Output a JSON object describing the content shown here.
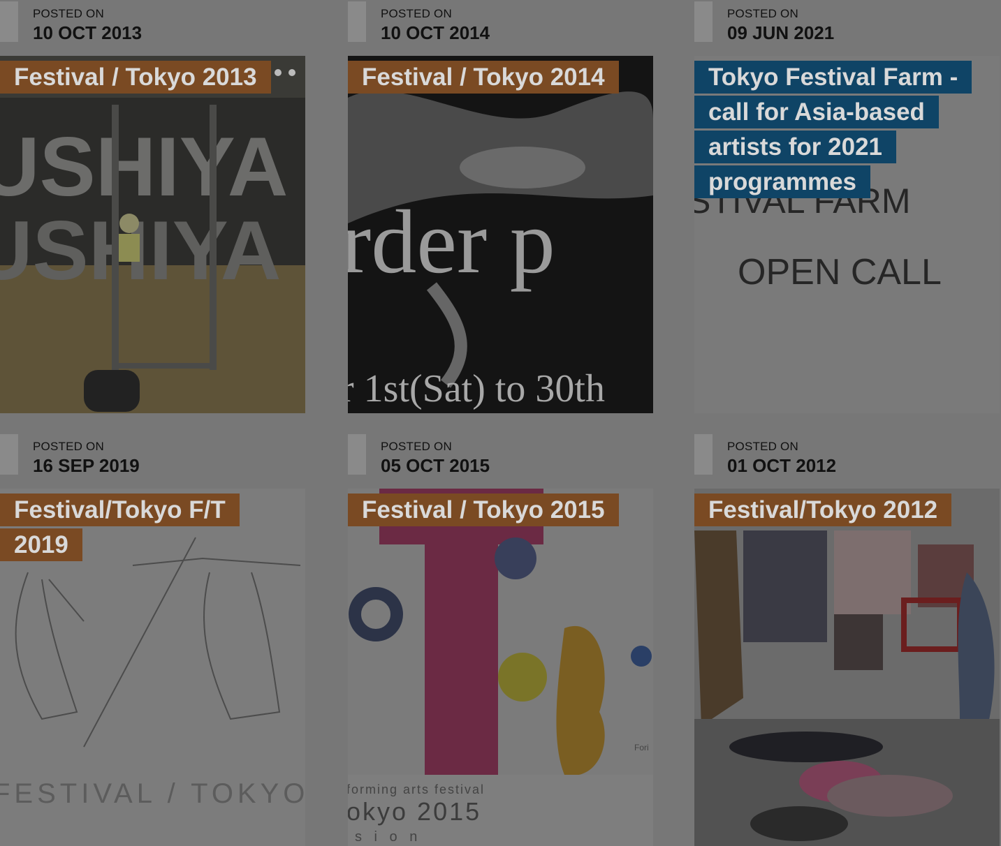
{
  "posts": [
    {
      "posted_label": "POSTED ON",
      "date": "10 OCT 2013",
      "title": "Festival / Tokyo 2013",
      "title_color": "#7a4a23",
      "image_text": "USHIYA"
    },
    {
      "posted_label": "POSTED ON",
      "date": "10 OCT 2014",
      "title": "Festival / Tokyo 2014",
      "title_color": "#7a4a23",
      "image_text_1": "rder p",
      "image_text_2": "r 1st(Sat) to 30th"
    },
    {
      "posted_label": "POSTED ON",
      "date": "09 JUN 2021",
      "title": "Tokyo Festival Farm - call for Asia-based artists for 2021 programmes",
      "title_color": "#0f4466",
      "image_text_1": "STIVAL FARM",
      "image_text_2": "OPEN CALL"
    },
    {
      "posted_label": "POSTED ON",
      "date": "16 SEP 2019",
      "title": "Festival/Tokyo F/T 2019",
      "title_color": "#7a4a23",
      "image_text": "FESTIVAL / TOKYO"
    },
    {
      "posted_label": "POSTED ON",
      "date": "05 OCT 2015",
      "title": "Festival / Tokyo 2015",
      "title_color": "#7a4a23",
      "image_text_1": "forming arts festival",
      "image_text_2": "okyo 2015",
      "image_text_3": "s i o n",
      "image_text_4": "Fori"
    },
    {
      "posted_label": "POSTED ON",
      "date": "01 OCT 2012",
      "title": "Festival/Tokyo 2012",
      "title_color": "#7a4a23"
    }
  ]
}
